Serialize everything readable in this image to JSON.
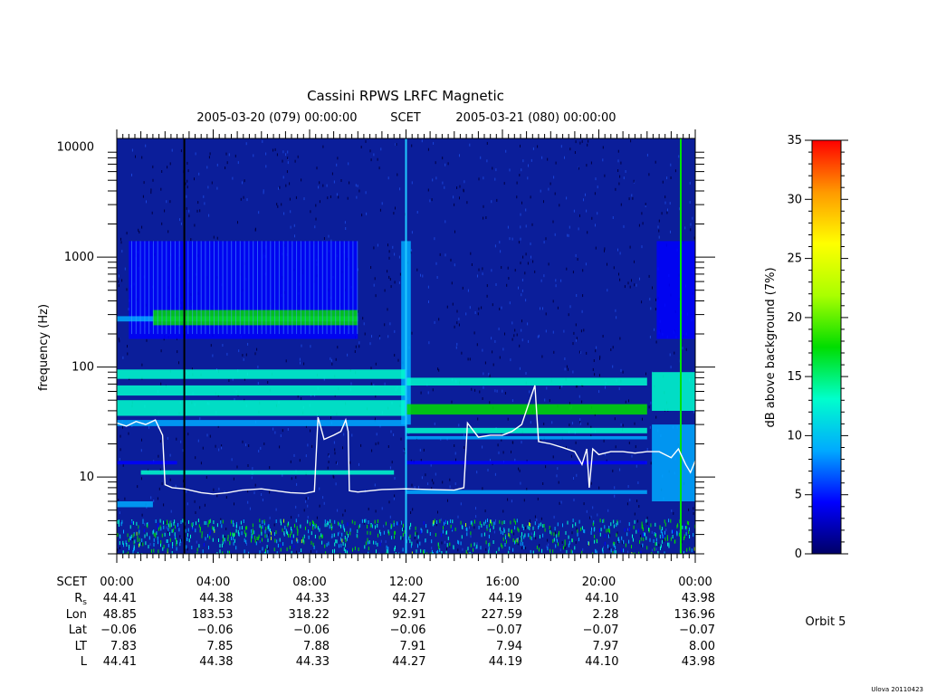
{
  "chart_data": {
    "type": "heatmap",
    "title": "Cassini RPWS LRFC Magnetic",
    "subtitle": {
      "start": "2005-03-20 (079) 00:00:00",
      "frame": "SCET",
      "end": "2005-03-21 (080) 00:00:00"
    },
    "ylabel": "frequency (Hz)",
    "yscale": "log",
    "ylim": [
      2,
      12000
    ],
    "y_tick_labels": [
      "10",
      "100",
      "1000",
      "10000"
    ],
    "y_tick_values": [
      10,
      100,
      1000,
      10000
    ],
    "xlim_hours": [
      0,
      24
    ],
    "x_tick_hours": [
      0,
      4,
      8,
      12,
      16,
      20,
      24
    ],
    "colorbar": {
      "label": "dB above background (7%)",
      "range": [
        0,
        35
      ],
      "tick_labels": [
        "0",
        "5",
        "10",
        "15",
        "20",
        "25",
        "30",
        "35"
      ],
      "tick_values": [
        0,
        5,
        10,
        15,
        20,
        25,
        30,
        35
      ],
      "colors": [
        "#000066",
        "#0000ff",
        "#00aaff",
        "#00ffcc",
        "#00dd00",
        "#aaff00",
        "#ffff00",
        "#ff9900",
        "#ff0000"
      ]
    },
    "ephemeris": {
      "labels": [
        "SCET",
        "Rs",
        "Lon",
        "Lat",
        "LT",
        "L"
      ],
      "rs_label": {
        "main": "R",
        "sub": "s"
      },
      "columns": [
        {
          "scet": "00:00",
          "rs": "44.41",
          "lon": "48.85",
          "lat": "−0.06",
          "lt": "7.83",
          "l": "44.41"
        },
        {
          "scet": "04:00",
          "rs": "44.38",
          "lon": "183.53",
          "lat": "−0.06",
          "lt": "7.85",
          "l": "44.38"
        },
        {
          "scet": "08:00",
          "rs": "44.33",
          "lon": "318.22",
          "lat": "−0.06",
          "lt": "7.88",
          "l": "44.33"
        },
        {
          "scet": "12:00",
          "rs": "44.27",
          "lon": "92.91",
          "lat": "−0.06",
          "lt": "7.91",
          "l": "44.27"
        },
        {
          "scet": "16:00",
          "rs": "44.19",
          "lon": "227.59",
          "lat": "−0.07",
          "lt": "7.94",
          "l": "44.19"
        },
        {
          "scet": "20:00",
          "rs": "44.10",
          "lon": "2.28",
          "lat": "−0.07",
          "lt": "7.97",
          "l": "44.10"
        },
        {
          "scet": "00:00",
          "rs": "43.98",
          "lon": "136.96",
          "lat": "−0.07",
          "lt": "8.00",
          "l": "43.98"
        }
      ]
    },
    "overlay_line": {
      "color": "#ffffff",
      "points": [
        [
          0,
          31
        ],
        [
          0.4,
          29
        ],
        [
          0.8,
          32
        ],
        [
          1.2,
          30
        ],
        [
          1.6,
          33
        ],
        [
          1.9,
          24
        ],
        [
          2.0,
          8.5
        ],
        [
          2.3,
          8.0
        ],
        [
          2.8,
          7.8
        ],
        [
          3.5,
          7.2
        ],
        [
          4.0,
          7.0
        ],
        [
          4.6,
          7.2
        ],
        [
          5.2,
          7.6
        ],
        [
          6.0,
          7.8
        ],
        [
          6.6,
          7.5
        ],
        [
          7.2,
          7.2
        ],
        [
          7.8,
          7.1
        ],
        [
          8.2,
          7.4
        ],
        [
          8.35,
          35
        ],
        [
          8.6,
          22
        ],
        [
          9.0,
          24
        ],
        [
          9.3,
          26
        ],
        [
          9.5,
          33
        ],
        [
          9.6,
          26
        ],
        [
          9.65,
          7.5
        ],
        [
          10.0,
          7.3
        ],
        [
          11.0,
          7.7
        ],
        [
          12.0,
          7.8
        ],
        [
          13.0,
          7.7
        ],
        [
          14.0,
          7.6
        ],
        [
          14.4,
          8.0
        ],
        [
          14.55,
          31
        ],
        [
          15.0,
          23
        ],
        [
          15.5,
          24
        ],
        [
          16.0,
          24
        ],
        [
          16.4,
          26
        ],
        [
          16.8,
          30
        ],
        [
          17.2,
          55
        ],
        [
          17.35,
          68
        ],
        [
          17.5,
          21
        ],
        [
          18.0,
          20
        ],
        [
          18.5,
          18.5
        ],
        [
          19.0,
          17
        ],
        [
          19.3,
          13
        ],
        [
          19.5,
          18
        ],
        [
          19.6,
          8
        ],
        [
          19.75,
          18
        ],
        [
          20.0,
          16
        ],
        [
          20.5,
          17
        ],
        [
          21.0,
          17
        ],
        [
          21.5,
          16.5
        ],
        [
          22.0,
          17
        ],
        [
          22.5,
          17
        ],
        [
          23.0,
          15
        ],
        [
          23.3,
          18
        ],
        [
          23.6,
          13
        ],
        [
          23.8,
          11
        ],
        [
          24.0,
          14
        ]
      ]
    },
    "annotations": {
      "orbit": "Orbit 5",
      "credit": "Ulova 20110423"
    }
  }
}
